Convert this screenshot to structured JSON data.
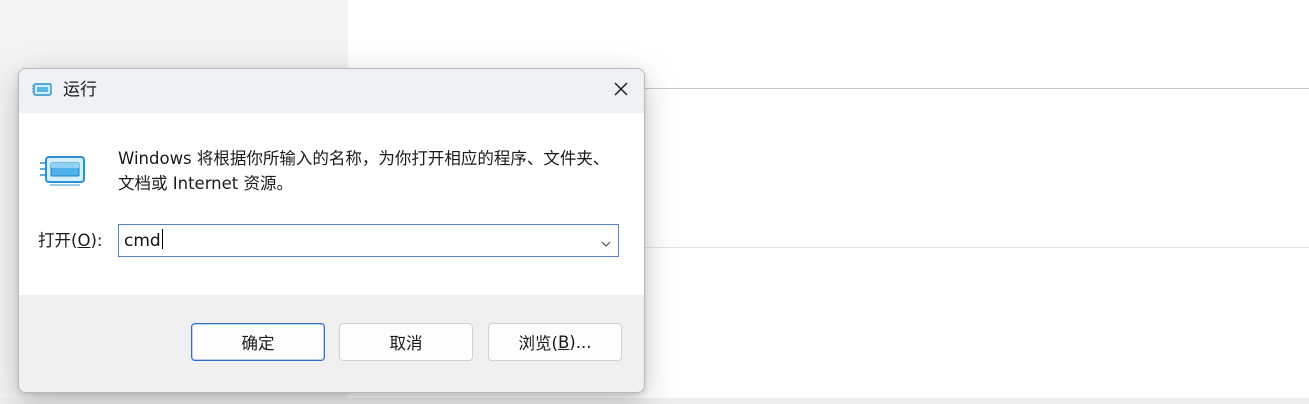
{
  "dialog": {
    "title": "运行",
    "close_label": "×",
    "description": "Windows 将根据你所输入的名称，为你打开相应的程序、文件夹、文档或 Internet 资源。",
    "open_label_prefix": "打开(",
    "open_label_accel": "O",
    "open_label_suffix": "):",
    "input_value": "cmd",
    "buttons": {
      "ok": "确定",
      "cancel": "取消",
      "browse_prefix": "浏览(",
      "browse_accel": "B",
      "browse_suffix": ")..."
    },
    "icons": {
      "title": "run-app-icon",
      "content": "run-app-icon",
      "close": "close-icon",
      "dropdown": "chevron-down-icon"
    },
    "colors": {
      "titlebar": "#eef2f7",
      "accent_border": "#2f6fc6",
      "input_border": "#5a84bd"
    }
  }
}
